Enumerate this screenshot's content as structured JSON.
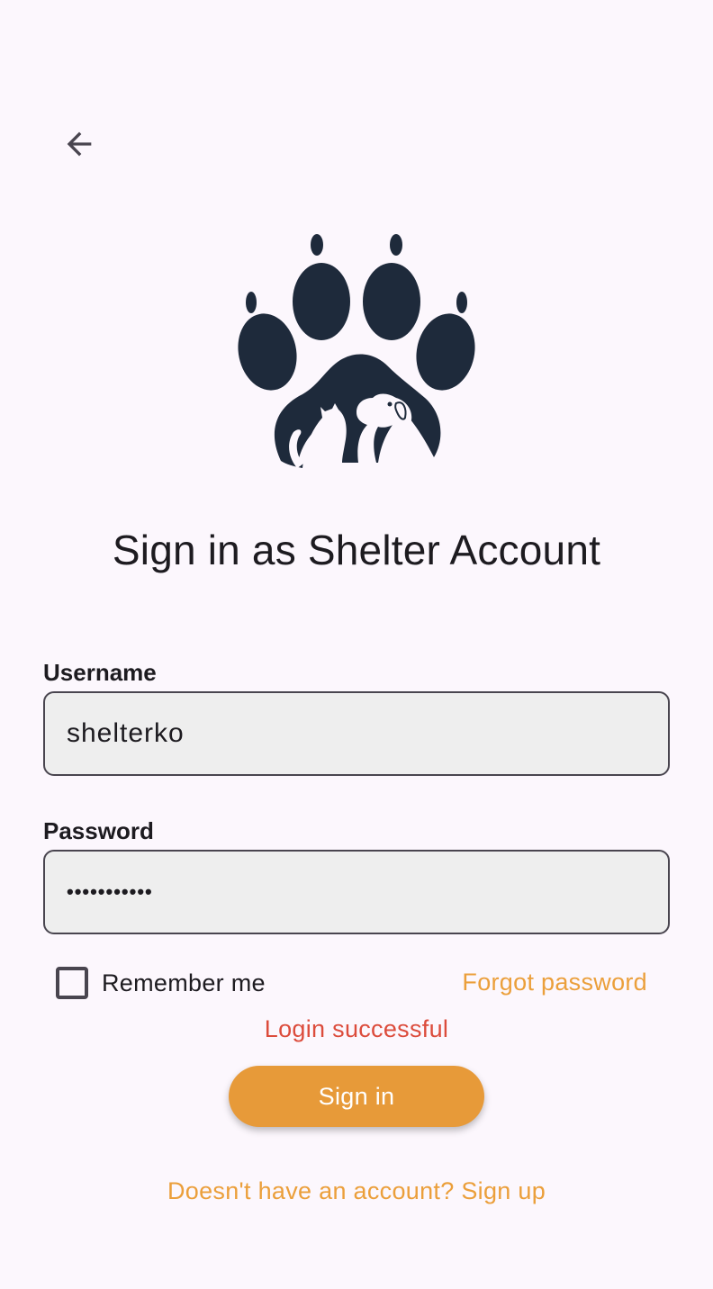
{
  "header": {
    "back_icon": "arrow-left-icon"
  },
  "logo": {
    "icon": "paw-with-cat-and-dog-icon",
    "color": "#1e2a3b"
  },
  "page": {
    "title": "Sign in as Shelter Account"
  },
  "form": {
    "username_label": "Username",
    "username_value": "shelterko",
    "password_label": "Password",
    "password_masked": "•••••••••••",
    "remember_label": "Remember me",
    "remember_checked": false,
    "forgot_label": "Forgot password",
    "status_message": "Login successful",
    "submit_label": "Sign in",
    "signup_label": "Doesn't have an account? Sign up"
  },
  "colors": {
    "accent": "#e79a39",
    "link": "#eb9f3b",
    "status": "#dc4c3c",
    "background": "#fcf7fd",
    "field_background": "#eeeeee"
  }
}
